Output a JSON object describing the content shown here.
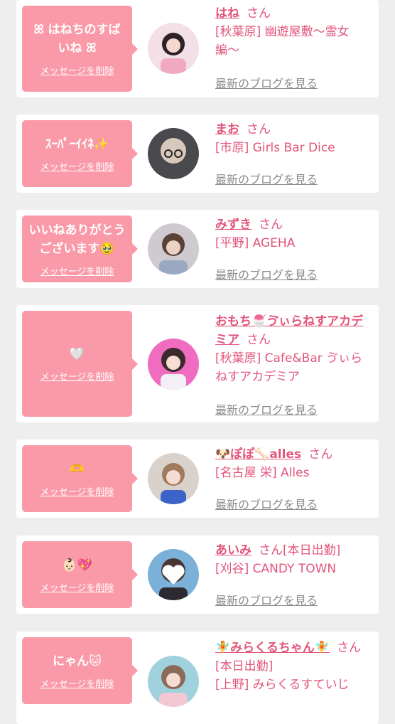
{
  "delete_label": "メッセージを削除",
  "blog_label": "最新のブログを見る",
  "san_label": "さん",
  "colors": {
    "bubble": "#fa9aa8",
    "accent": "#e2547a",
    "link_gray": "#8a8a8a",
    "background": "#eeeeee"
  },
  "cards": [
    {
      "message": "ꕤ はねちのすば\nいね ꕤ",
      "name": "はね",
      "suffix": "",
      "shop": "[秋葉原] 幽遊屋敷〜霊女編〜"
    },
    {
      "message": "ｽｰﾊﾟｰｲｲﾈ✨",
      "name": "まお",
      "suffix": "",
      "shop": "[市原] Girls Bar Dice"
    },
    {
      "message": "いいねありがとう\nございます🥹",
      "name": "みずき",
      "suffix": "",
      "shop": "[平野] AGEHA"
    },
    {
      "message": "🤍",
      "name": "おもち🍧ゔぃらねすアカデミア",
      "suffix": "",
      "shop": "[秋葉原] Cafe&Bar ゔぃらねすアカデミア"
    },
    {
      "message": "🫶",
      "name": "🐶ぽぽ🦴alles",
      "suffix": "",
      "shop": "[名古屋 栄] Alles"
    },
    {
      "message": "👶🏻💖",
      "name": "あいみ",
      "suffix": "[本日出勤]",
      "shop": "[刈谷] CANDY TOWN"
    },
    {
      "message": "にゃん🐱",
      "name": "🧚みらくるちゃん🧚",
      "suffix": "[本日出勤]",
      "shop": "[上野] みらくるすていじ"
    }
  ]
}
